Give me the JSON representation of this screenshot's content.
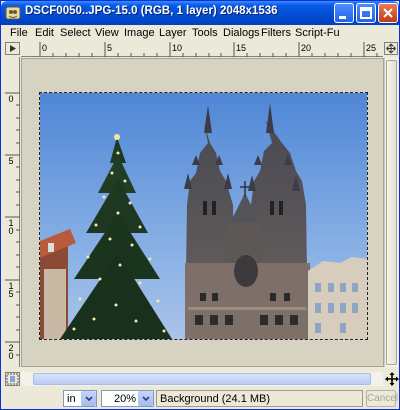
{
  "window": {
    "title": "DSCF0050..JPG-15.0 (RGB, 1 layer) 2048x1536",
    "accent": "#0150d8"
  },
  "menu": [
    "File",
    "Edit",
    "Select",
    "View",
    "Image",
    "Layer",
    "Tools",
    "Dialogs",
    "Filters",
    "Script-Fu"
  ],
  "rulers": {
    "horizontal_labels": [
      "0",
      "5",
      "10",
      "15",
      "20",
      "25"
    ],
    "vertical_labels": [
      "0",
      "5",
      "1\n0",
      "1\n5",
      "2\n0"
    ]
  },
  "icons": {
    "app": "gimp-icon",
    "minimize": "minimize-icon",
    "maximize": "maximize-icon",
    "close": "close-icon",
    "quick_mask": "quick-mask-icon",
    "navigate": "navigate-icon",
    "move": "move-icon"
  },
  "status": {
    "unit": "in",
    "zoom": "20%",
    "layer_info": "Background (24.1 MB)",
    "cancel_label": "Cancel"
  },
  "colors": {
    "sky": "#6f9ad8",
    "canvas_bg": "#d6d3c2"
  }
}
